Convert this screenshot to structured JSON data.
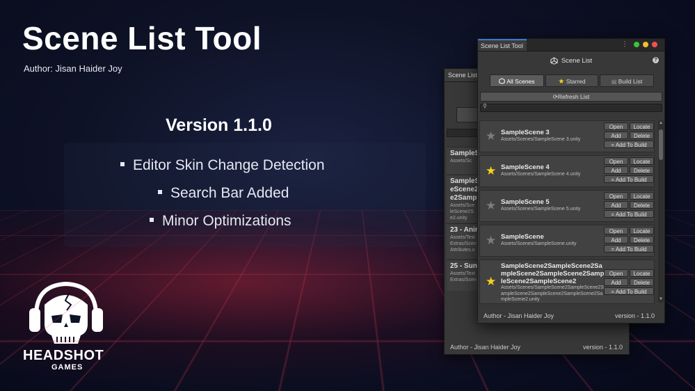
{
  "slide": {
    "title": "Scene List Tool",
    "author": "Author: Jisan Haider Joy",
    "version": "Version 1.1.0",
    "features": [
      "Editor Skin Change Detection",
      "Search Bar Added",
      "Minor Optimizations"
    ]
  },
  "logo": {
    "name": "HEADSHOT",
    "sub": "GAMES"
  },
  "back_window": {
    "tab": "Scene List",
    "items": [
      {
        "title": "SampleS",
        "sub": "Assets/Sc"
      },
      {
        "title": "SampleS eScene2 e2Samp",
        "sub": "Assets/Sce leScene2S e2.unity"
      },
      {
        "title": "23 - Anir",
        "sub": "Assets/Text Extras/Scen Attributes.u"
      },
      {
        "title": "25 - Sun",
        "sub": "Assets/Text Extras/Scen"
      }
    ],
    "footer_author": "Author - Jisan Haider Joy",
    "footer_version": "version - 1.1.0"
  },
  "window": {
    "tab": "Scene List Tool",
    "header": "Scene List",
    "help_icon": "?",
    "tabs": {
      "all": "All Scenes",
      "starred": "Starred",
      "build": "Build List"
    },
    "refresh": "Refresh List",
    "search_placeholder": "",
    "buttons": {
      "open": "Open",
      "locate": "Locate",
      "add": "Add",
      "delete": "Delete",
      "add_to_build": "= Add To Build"
    },
    "items": [
      {
        "name": "SampleScene 3",
        "path": "Assets/Scenes/SampleScene 3.unity",
        "starred": false
      },
      {
        "name": "SampleScene 4",
        "path": "Assets/Scenes/SampleScene 4.unity",
        "starred": true
      },
      {
        "name": "SampleScene 5",
        "path": "Assets/Scenes/SampleScene 5.unity",
        "starred": false
      },
      {
        "name": "SampleScene",
        "path": "Assets/Scenes/SampleScene.unity",
        "starred": false
      },
      {
        "name": "SampleScene2SampleScene2SampleScene2SampleScene2SampleScene2SampleScene2",
        "path": "Assets/Scenes/SampleScene2SampleScene2SampleScene2SampleScene2SampleScene2SampleScene2.unity",
        "starred": true
      }
    ],
    "footer_author": "Author - Jisan Haider Joy",
    "footer_version": "version - 1.1.0"
  },
  "colors": {
    "accent_tab": "#3a79d8",
    "star": "#f7d21a",
    "close": "#f25056",
    "minimize": "#f8bc2e",
    "maximize": "#39c43f"
  }
}
